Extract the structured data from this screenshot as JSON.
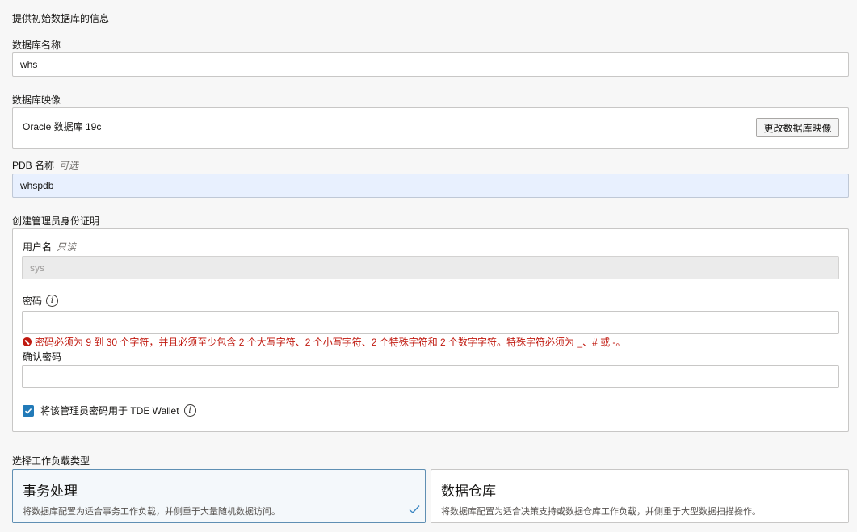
{
  "section_title": "提供初始数据库的信息",
  "db_name": {
    "label": "数据库名称",
    "value": "whs"
  },
  "db_image": {
    "label": "数据库映像",
    "value": "Oracle 数据库 19c",
    "change_button": "更改数据库映像"
  },
  "pdb": {
    "label": "PDB 名称",
    "optional": "可选",
    "value": "whspdb"
  },
  "admin": {
    "label": "创建管理员身份证明",
    "username_label": "用户名",
    "username_readonly": "只读",
    "username_value": "sys",
    "password_label": "密码",
    "password_error": "密码必须为 9 到 30 个字符，并且必须至少包含 2 个大写字符、2 个小写字符、2 个特殊字符和 2 个数字字符。特殊字符必须为 _、# 或 -。",
    "confirm_label": "确认密码",
    "tde_checkbox_label": "将该管理员密码用于 TDE Wallet",
    "tde_checked": true
  },
  "workload": {
    "label": "选择工作负载类型",
    "options": [
      {
        "title": "事务处理",
        "desc": "将数据库配置为适合事务工作负载，并侧重于大量随机数据访问。",
        "selected": true
      },
      {
        "title": "数据仓库",
        "desc": "将数据库配置为适合决策支持或数据仓库工作负载，并侧重于大型数据扫描操作。",
        "selected": false
      }
    ]
  },
  "colors": {
    "accent": "#227ab8",
    "error": "#c0190f",
    "autofill": "#e8f0fe"
  }
}
